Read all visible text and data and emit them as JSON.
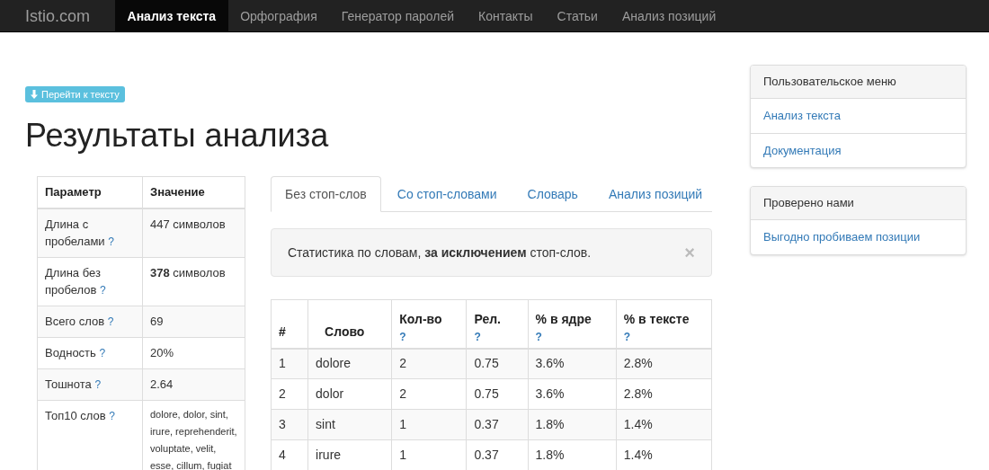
{
  "navbar": {
    "brand": "Istio.com",
    "items": [
      {
        "label": "Анализ текста",
        "selected": true
      },
      {
        "label": "Орфография",
        "selected": false
      },
      {
        "label": "Генератор паролей",
        "selected": false
      },
      {
        "label": "Контакты",
        "selected": false
      },
      {
        "label": "Статьи",
        "selected": false
      },
      {
        "label": "Анализ позиций",
        "selected": false
      }
    ]
  },
  "jump_button": {
    "label": "Перейти к тексту"
  },
  "title": "Результаты анализа",
  "params_table": {
    "columns": [
      "Параметр",
      "Значение"
    ],
    "rows": [
      {
        "label": "Длина с пробелами",
        "help": "?",
        "value": "447 символов",
        "kind": "text"
      },
      {
        "label": "Длина без пробелов",
        "help": "?",
        "value": "**378** символов",
        "kind": "text"
      },
      {
        "label": "Всего слов",
        "help": "?",
        "value": "69",
        "kind": "text"
      },
      {
        "label": "Водность",
        "help": "?",
        "value": "20%",
        "kind": "text"
      },
      {
        "label": "Тошнота",
        "help": "?",
        "value": "2.64",
        "kind": "text"
      },
      {
        "label": "Топ10 слов",
        "help": "?",
        "value": "dolore, dolor, sint, irure, reprehenderit, voluptate, velit, esse, cillum, fugiat",
        "kind": "small"
      }
    ]
  },
  "tabs": [
    {
      "label": "Без стоп-слов",
      "selected": true
    },
    {
      "label": "Со стоп-словами",
      "selected": false
    },
    {
      "label": "Словарь",
      "selected": false
    },
    {
      "label": "Анализ позиций",
      "selected": false
    }
  ],
  "alert": {
    "text": "Статистика по словам, **за исключением** стоп-слов.",
    "close": "×"
  },
  "words_table": {
    "columns": [
      {
        "label": "#"
      },
      {
        "label": "Слово"
      },
      {
        "label": "Кол-во",
        "help": "?"
      },
      {
        "label": "Рел.",
        "help": "?"
      },
      {
        "label": "% в ядре",
        "help": "?"
      },
      {
        "label": "% в тексте",
        "help": "?"
      }
    ],
    "rows": [
      [
        "1",
        "dolore",
        "2",
        "0.75",
        "3.6%",
        "2.8%"
      ],
      [
        "2",
        "dolor",
        "2",
        "0.75",
        "3.6%",
        "2.8%"
      ],
      [
        "3",
        "sint",
        "1",
        "0.37",
        "1.8%",
        "1.4%"
      ],
      [
        "4",
        "irure",
        "1",
        "0.37",
        "1.8%",
        "1.4%"
      ]
    ]
  },
  "panels": [
    {
      "title": "Пользовательское меню",
      "links": [
        "Анализ текста",
        "Документация"
      ]
    },
    {
      "title": "Проверено нами",
      "links": [
        "Выгодно пробиваем позиции"
      ]
    }
  ]
}
